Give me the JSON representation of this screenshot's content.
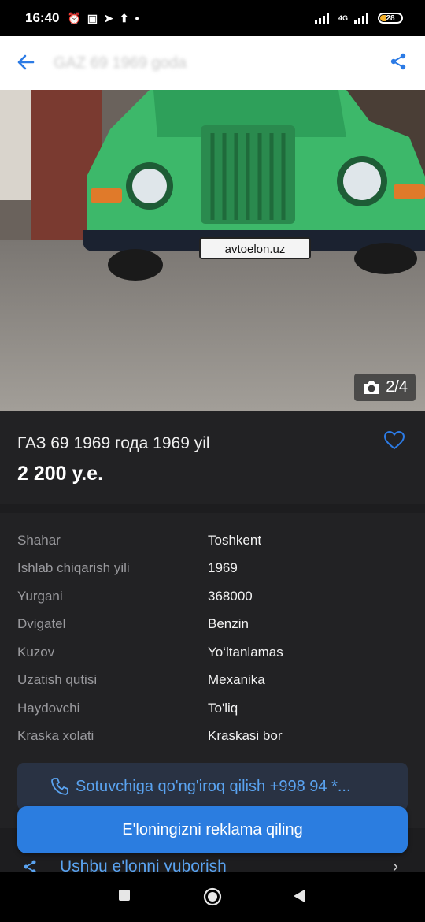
{
  "status_bar": {
    "time": "16:40",
    "network": "4G",
    "battery": "28"
  },
  "app_bar": {
    "title": "GAZ 69 1969 goda"
  },
  "photo": {
    "plate_text": "avtoelon.uz",
    "counter": "2/4"
  },
  "listing": {
    "title": "ГАЗ 69 1969 года 1969 yil",
    "price": "2 200 у.е."
  },
  "specs": [
    {
      "key": "Shahar",
      "value": "Toshkent"
    },
    {
      "key": "Ishlab chiqarish yili",
      "value": "1969"
    },
    {
      "key": "Yurgani",
      "value": "368000"
    },
    {
      "key": "Dvigatel",
      "value": "Benzin"
    },
    {
      "key": "Kuzov",
      "value": "Yo‘ltanlamas"
    },
    {
      "key": "Uzatish qutisi",
      "value": "Mexanika"
    },
    {
      "key": "Haydovchi",
      "value": "To'liq"
    },
    {
      "key": "Kraska xolati",
      "value": "Kraskasi bor"
    }
  ],
  "call_button": {
    "label": "Sotuvchiga qo'ng'iroq qilish +998 94 *..."
  },
  "cta_button": {
    "label": "E'loningizni reklama qiling"
  },
  "share_row": {
    "label": "Ushbu e'lonni yuborish"
  },
  "colors": {
    "accent": "#2b7de0",
    "link": "#5aa3f0",
    "background": "#1d1d1f",
    "card": "#222224"
  }
}
